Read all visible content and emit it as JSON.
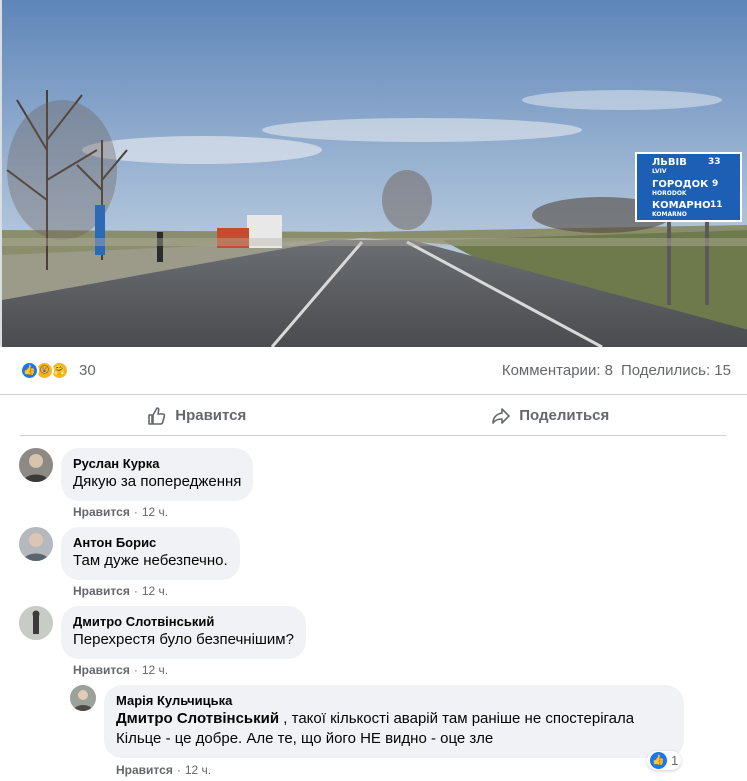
{
  "photo": {
    "signs": [
      {
        "city": "ЛЬВІВ",
        "latin": "LVIV",
        "distance": "33"
      },
      {
        "city": "ГОРОДОК",
        "latin": "HORODOK",
        "distance": "9"
      },
      {
        "city": "КОМАРНО",
        "latin": "KOMARNO",
        "distance": "11"
      }
    ]
  },
  "stats": {
    "reaction_count": "30",
    "comments": "Комментарии: 8",
    "shares": "Поделились: 15"
  },
  "actions": {
    "like": "Нравится",
    "share": "Поделиться"
  },
  "comments": [
    {
      "author": "Руслан Курка",
      "text": "Дякую за попередження",
      "like": "Нравится",
      "time": "12 ч."
    },
    {
      "author": "Антон Борис",
      "text": "Там дуже небезпечно.",
      "like": "Нравится",
      "time": "12 ч."
    },
    {
      "author": "Дмитро Слотвінський",
      "text": "Перехрестя було безпечнішим?",
      "like": "Нравится",
      "time": "12 ч."
    }
  ],
  "reply": {
    "author": "Марія Кульчицька",
    "mention": "Дмитро Слотвінський",
    "text_line1": " , такої кількості аварій там раніше не спостерігала",
    "text_line2": "Кільце - це добре. Але те, що його НЕ видно - оце зле",
    "like": "Нравится",
    "time": "12 ч.",
    "like_count": "1"
  },
  "colors": {
    "facebook_blue": "#1877f2",
    "secondary_text": "#65676b",
    "bubble": "#f0f2f5",
    "sign_blue": "#1c5fb5"
  }
}
